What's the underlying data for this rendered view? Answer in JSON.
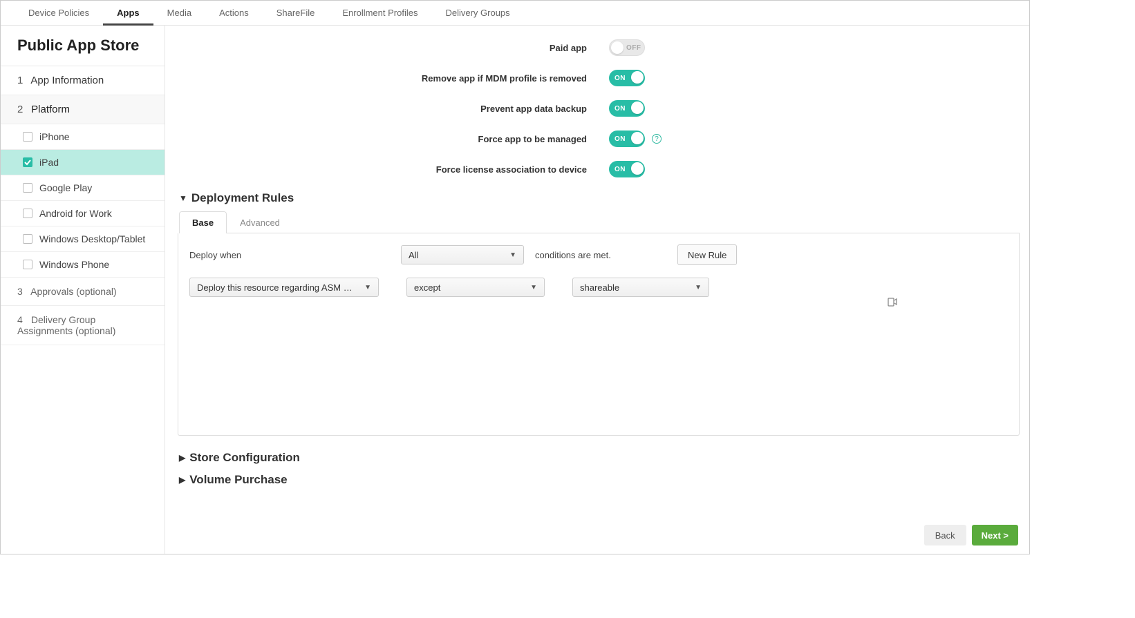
{
  "topnav": {
    "items": [
      "Device Policies",
      "Apps",
      "Media",
      "Actions",
      "ShareFile",
      "Enrollment Profiles",
      "Delivery Groups"
    ],
    "active_index": 1
  },
  "sidebar": {
    "title": "Public App Store",
    "steps": [
      {
        "num": "1",
        "label": "App Information"
      },
      {
        "num": "2",
        "label": "Platform"
      }
    ],
    "platforms": [
      {
        "label": "iPhone",
        "checked": false
      },
      {
        "label": "iPad",
        "checked": true
      },
      {
        "label": "Google Play",
        "checked": false
      },
      {
        "label": "Android for Work",
        "checked": false
      },
      {
        "label": "Windows Desktop/Tablet",
        "checked": false
      },
      {
        "label": "Windows Phone",
        "checked": false
      }
    ],
    "optional": [
      {
        "num": "3",
        "label": "Approvals (optional)"
      },
      {
        "num": "4",
        "label": "Delivery Group Assignments (optional)"
      }
    ]
  },
  "settings": {
    "paid_app": {
      "label": "Paid app",
      "state": "OFF"
    },
    "remove_mdm": {
      "label": "Remove app if MDM profile is removed",
      "state": "ON"
    },
    "prevent_backup": {
      "label": "Prevent app data backup",
      "state": "ON"
    },
    "force_managed": {
      "label": "Force app to be managed",
      "state": "ON",
      "help": true
    },
    "force_license": {
      "label": "Force license association to device",
      "state": "ON"
    }
  },
  "deployment_rules": {
    "title": "Deployment Rules",
    "tabs": [
      "Base",
      "Advanced"
    ],
    "active_tab": 0,
    "deploy_when_label": "Deploy when",
    "all_selector": "All",
    "conditions_met_label": "conditions are met.",
    "new_rule_label": "New Rule",
    "rule": {
      "resource": "Deploy this resource regarding ASM     …",
      "op": "except",
      "value": "shareable"
    }
  },
  "store_config": {
    "title": "Store Configuration"
  },
  "volume_purchase": {
    "title": "Volume Purchase"
  },
  "footer": {
    "back": "Back",
    "next": "Next >"
  }
}
